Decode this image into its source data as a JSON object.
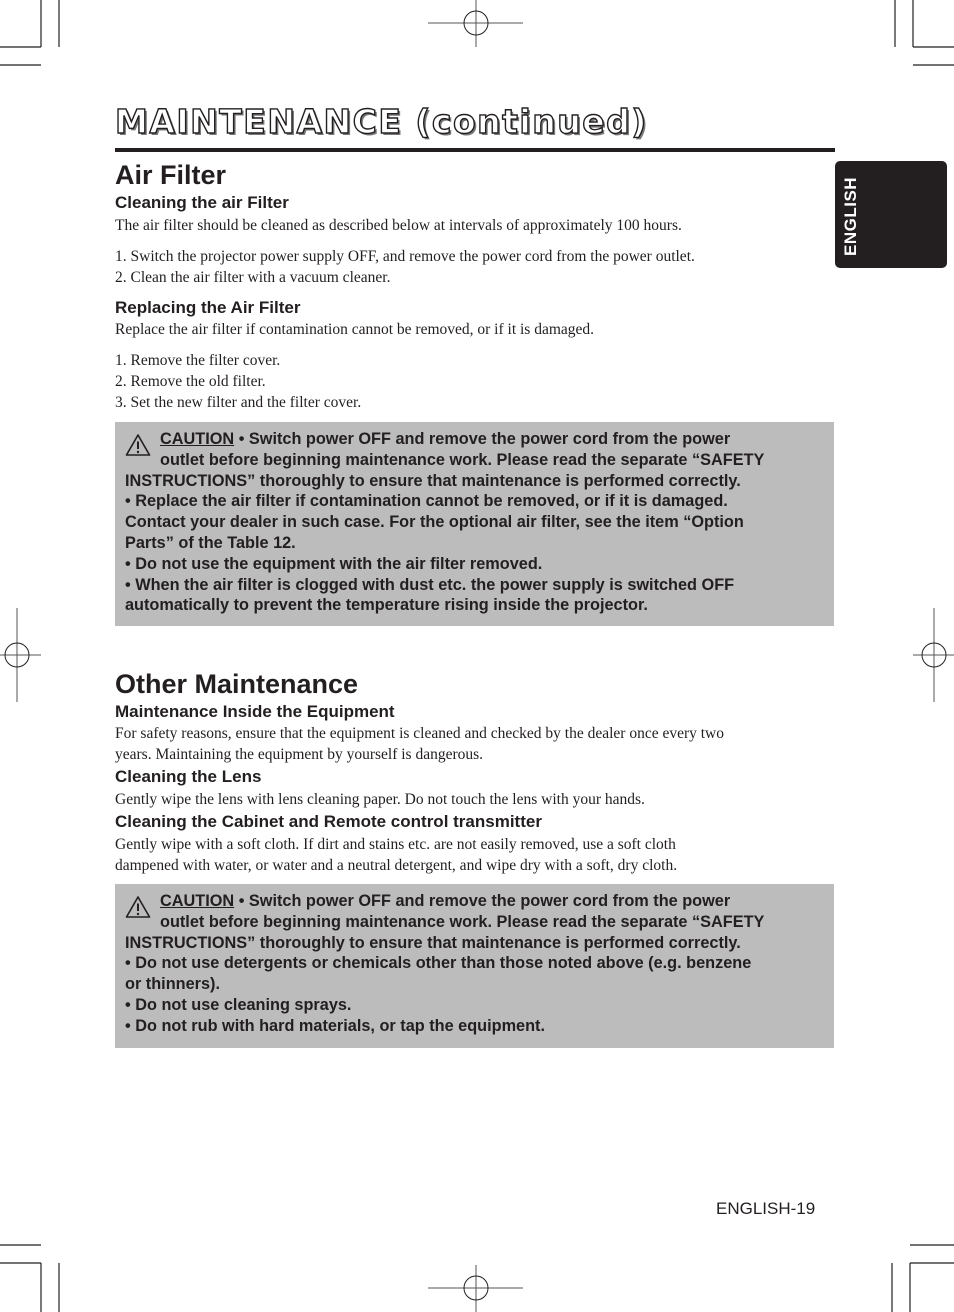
{
  "page": {
    "title": "MAINTENANCE (continued)",
    "language_tab": "ENGLISH",
    "page_number": "ENGLISH-19"
  },
  "air_filter": {
    "heading": "Air Filter",
    "cleaning": {
      "subheading": "Cleaning the air Filter",
      "intro": "The air filter should be cleaned as described below at intervals of approximately 100 hours.",
      "steps": [
        "1. Switch the projector power supply OFF, and remove the power cord from the power outlet.",
        "2. Clean the air filter with a vacuum cleaner."
      ]
    },
    "replacing": {
      "subheading": "Replacing the Air Filter",
      "intro": "Replace the air filter if contamination cannot be removed, or if it is damaged.",
      "steps": [
        "1. Remove the filter cover.",
        "2. Remove the old filter.",
        "3. Set the new filter and the filter cover."
      ]
    },
    "caution": {
      "label": "CAUTION",
      "icon": "warning-triangle-icon",
      "lines": [
        " • Switch power OFF and remove the power cord from the power",
        "outlet before beginning maintenance work. Please read the separate “SAFETY",
        "INSTRUCTIONS” thoroughly to ensure that maintenance is performed correctly.",
        "• Replace the air filter if contamination cannot be removed, or if it is damaged.",
        "Contact your dealer in such case. For the optional air filter, see the item “Option",
        "Parts” of the Table 12.",
        "• Do not use the equipment with the air filter removed.",
        "• When the air filter is clogged with dust etc. the power supply is switched OFF",
        "automatically to prevent the temperature rising inside the projector."
      ]
    }
  },
  "other_maintenance": {
    "heading": "Other Maintenance",
    "inside": {
      "subheading": "Maintenance Inside the Equipment",
      "lines": [
        "For safety reasons, ensure that the equipment is cleaned and checked by the dealer once every two",
        "years. Maintaining the equipment by yourself is dangerous."
      ]
    },
    "lens": {
      "subheading": "Cleaning the Lens",
      "lines": [
        "Gently wipe the lens with lens cleaning paper. Do not touch the lens with your hands."
      ]
    },
    "cabinet": {
      "subheading": "Cleaning the Cabinet and Remote control transmitter",
      "lines": [
        "Gently wipe with a soft cloth. If dirt and stains etc. are not easily removed, use a soft cloth",
        "dampened with water, or water and a neutral detergent, and wipe dry with a soft, dry cloth."
      ]
    },
    "caution": {
      "label": "CAUTION",
      "icon": "warning-triangle-icon",
      "lines": [
        " • Switch power OFF and remove the power cord from the power",
        "outlet before beginning maintenance work. Please read the separate “SAFETY",
        "INSTRUCTIONS” thoroughly to ensure that maintenance is performed correctly.",
        "• Do not use detergents or chemicals other than those noted above (e.g. benzene",
        "or thinners).",
        "• Do not use cleaning sprays.",
        "• Do not rub with hard materials, or tap the equipment."
      ]
    }
  },
  "colors": {
    "ink": "#231f20",
    "caution_bg": "#bcbcbc",
    "tab_bg": "#231f20"
  }
}
